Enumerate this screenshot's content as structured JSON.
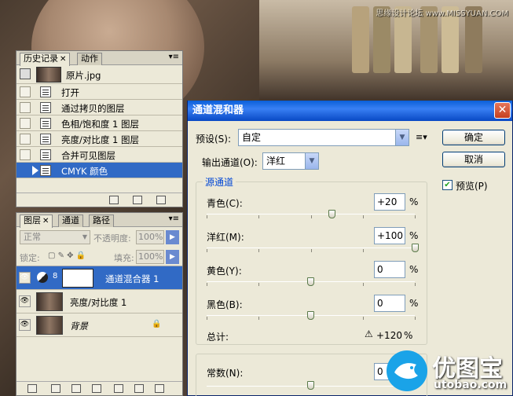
{
  "watermark": "思缘设计论坛 www.MISSYUAN.COM",
  "history_panel": {
    "tabs": [
      {
        "label": "历史记录"
      },
      {
        "label": "动作"
      }
    ],
    "snapshot": {
      "label": "原片.jpg"
    },
    "items": [
      {
        "label": "打开"
      },
      {
        "label": "通过拷贝的图层"
      },
      {
        "label": "色相/饱和度 1 图层"
      },
      {
        "label": "亮度/对比度 1 图层"
      },
      {
        "label": "合并可见图层"
      },
      {
        "label": "CMYK 颜色",
        "selected": true
      }
    ]
  },
  "layers_panel": {
    "tabs": [
      {
        "label": "图层"
      },
      {
        "label": "通道"
      },
      {
        "label": "路径"
      }
    ],
    "blend_mode": "正常",
    "opacity_label": "不透明度:",
    "opacity_value": "100%",
    "lock_label": "锁定:",
    "fill_label": "填充:",
    "fill_value": "100%",
    "layers": [
      {
        "name": "通道混合器 1",
        "selected": true
      },
      {
        "name": "亮度/对比度 1"
      },
      {
        "name": "背景",
        "locked": true
      }
    ]
  },
  "dialog": {
    "title": "通道混和器",
    "preset_label": "预设(S):",
    "preset_value": "自定",
    "output_label": "输出通道(O):",
    "output_value": "洋红",
    "ok_label": "确定",
    "cancel_label": "取消",
    "preview_label": "预览(P)",
    "preview_checked": true,
    "source_group_title": "源通道",
    "sources": [
      {
        "label": "青色(C):",
        "value": "+20",
        "level": 0.6
      },
      {
        "label": "洋红(M):",
        "value": "+100",
        "level": 1.0
      },
      {
        "label": "黄色(Y):",
        "value": "0",
        "level": 0.5
      },
      {
        "label": "黑色(B):",
        "value": "0",
        "level": 0.5
      }
    ],
    "total_label": "总计:",
    "total_value": "+120",
    "constant_label": "常数(N):",
    "constant_value": "0",
    "constant_level": 0.5,
    "percent_sign": "%"
  },
  "logo": {
    "title": "优图宝",
    "subtitle": "utobao.com"
  },
  "colors": {
    "selection": "#316ac5",
    "title_bar": "#0a5fd8",
    "logo_blue": "#1aa3e8"
  }
}
